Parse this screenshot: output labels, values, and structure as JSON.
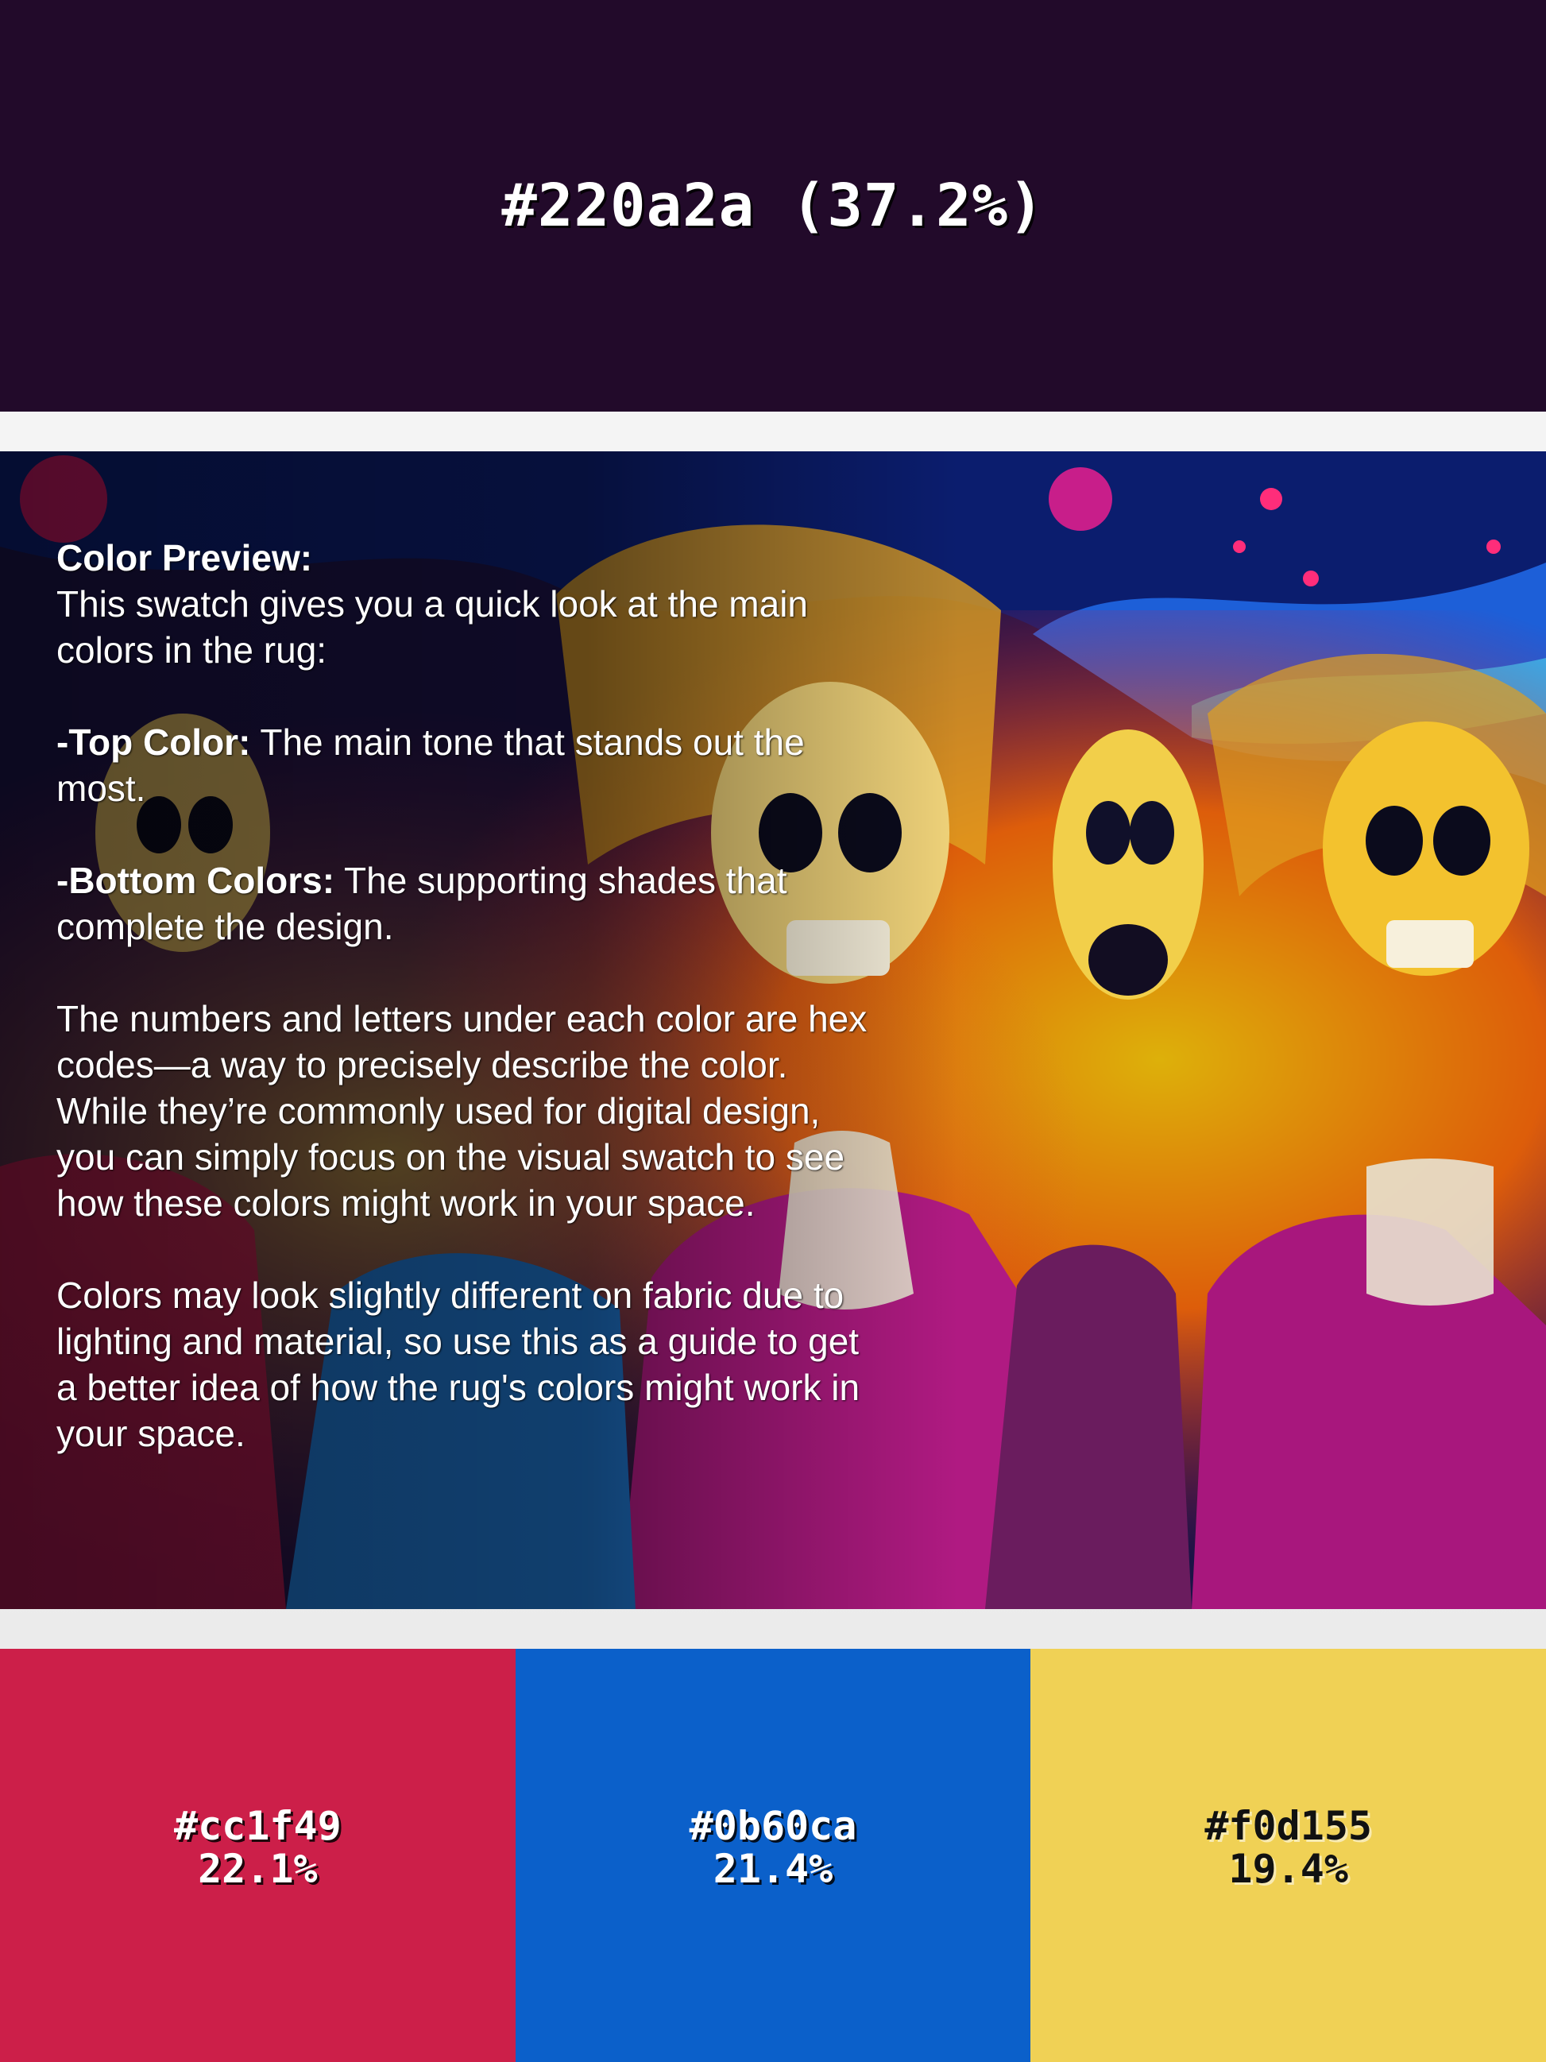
{
  "top_color": {
    "label": "#220a2a (37.2%)",
    "hex": "#220a2a"
  },
  "preview": {
    "heading": "Color Preview:",
    "intro_line": "This swatch gives you a quick look at the main colors in the rug:",
    "top_color_label": "-Top Color:",
    "top_color_text": " The main tone that stands out the most.",
    "bottom_colors_label": "-Bottom Colors:",
    "bottom_colors_text": " The supporting shades that complete the design.",
    "hex_explanation": "The numbers and letters under each color are hex codes—a way to precisely describe the color. While they’re commonly used for digital design, you can simply focus on the visual swatch to see how these colors might work in your space.",
    "disclaimer": "Colors may look slightly different on fabric due to lighting and material, so use this as a guide to get a better idea of how the rug's colors might work in your space."
  },
  "swatches": [
    {
      "hex": "#cc1f49",
      "pct": "22.1%",
      "color": "#cc1f49",
      "text_tone": "light"
    },
    {
      "hex": "#0b60ca",
      "pct": "21.4%",
      "color": "#0b60ca",
      "text_tone": "light"
    },
    {
      "hex": "#f0d155",
      "pct": "19.4%",
      "color": "#f0d155",
      "text_tone": "dark"
    }
  ]
}
